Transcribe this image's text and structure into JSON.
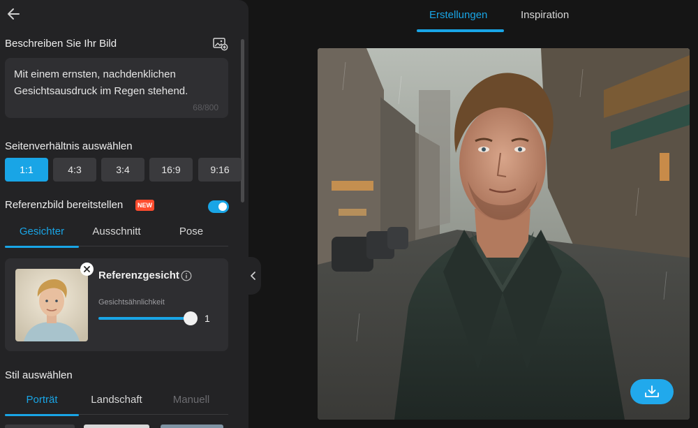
{
  "left_panel": {
    "prompt_section": {
      "title": "Beschreiben Sie Ihr Bild",
      "prompt_text": "Mit einem ernsten, nachdenklichen Gesichtsausdruck im Regen stehend.",
      "char_count": "68/800"
    },
    "ratio_section": {
      "title": "Seitenverhältnis auswählen",
      "options": [
        "1:1",
        "4:3",
        "3:4",
        "16:9",
        "9:16"
      ],
      "selected": "1:1"
    },
    "reference_section": {
      "title": "Referenzbild bereitstellen",
      "badge": "NEW",
      "enabled": true,
      "tabs": [
        "Gesichter",
        "Ausschnitt",
        "Pose"
      ],
      "active_tab": "Gesichter",
      "card": {
        "title": "Referenzgesicht",
        "slider_label": "Gesichtsähnlichkeit",
        "slider_value": "1"
      }
    },
    "style_section": {
      "title": "Stil auswählen",
      "tabs": [
        "Porträt",
        "Landschaft",
        "Manuell"
      ],
      "active_tab": "Porträt"
    }
  },
  "top_tabs": {
    "items": [
      "Erstellungen",
      "Inspiration"
    ],
    "active": "Erstellungen"
  },
  "icons": {
    "back": "arrow-left-icon",
    "image_prompt": "image-add-icon",
    "info": "info-icon",
    "close": "close-icon",
    "collapse": "chevron-left-icon",
    "download": "download-icon"
  },
  "colors": {
    "accent": "#19a5e6",
    "panel_bg": "#232325",
    "page_bg": "#151515",
    "badge": "#ff4c2e"
  }
}
